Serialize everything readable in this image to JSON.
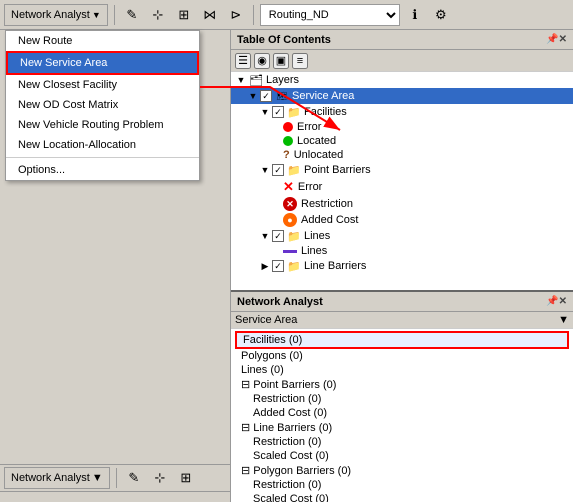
{
  "toolbar": {
    "network_analyst_label": "Network Analyst",
    "dropdown_arrow": "▼",
    "network_dropdown_value": "Routing_ND"
  },
  "dropdown_menu": {
    "items": [
      {
        "id": "new-route",
        "label": "New Route",
        "selected": false
      },
      {
        "id": "new-service-area",
        "label": "New Service Area",
        "selected": true
      },
      {
        "id": "new-closest-facility",
        "label": "New Closest Facility",
        "selected": false
      },
      {
        "id": "new-od-cost-matrix",
        "label": "New OD Cost Matrix",
        "selected": false
      },
      {
        "id": "new-vehicle-routing",
        "label": "New Vehicle Routing Problem",
        "selected": false
      },
      {
        "id": "new-location-allocation",
        "label": "New Location-Allocation",
        "selected": false
      },
      {
        "id": "options",
        "label": "Options...",
        "selected": false
      }
    ]
  },
  "toc": {
    "title": "Table Of Contents",
    "layers_label": "Layers",
    "tree": [
      {
        "id": "layers",
        "label": "Layers",
        "level": 0,
        "type": "folder",
        "expanded": true
      },
      {
        "id": "service-area",
        "label": "Service Area",
        "level": 1,
        "type": "layer",
        "checked": true,
        "expanded": true
      },
      {
        "id": "facilities",
        "label": "Facilities",
        "level": 2,
        "type": "group",
        "checked": true,
        "expanded": true
      },
      {
        "id": "error",
        "label": "Error",
        "level": 3,
        "type": "legend-red-dot"
      },
      {
        "id": "located",
        "label": "Located",
        "level": 3,
        "type": "legend-green-dot"
      },
      {
        "id": "unlocated",
        "label": "Unlocated",
        "level": 3,
        "type": "legend-question"
      },
      {
        "id": "point-barriers",
        "label": "Point Barriers",
        "level": 2,
        "type": "group",
        "checked": true,
        "expanded": true
      },
      {
        "id": "point-error",
        "label": "Error",
        "level": 3,
        "type": "legend-red-x"
      },
      {
        "id": "restriction",
        "label": "Restriction",
        "level": 3,
        "type": "legend-red-circle-x"
      },
      {
        "id": "added-cost",
        "label": "Added Cost",
        "level": 3,
        "type": "legend-orange-circle"
      },
      {
        "id": "lines",
        "label": "Lines",
        "level": 2,
        "type": "group",
        "checked": true,
        "expanded": true
      },
      {
        "id": "lines-item",
        "label": "Lines",
        "level": 3,
        "type": "legend-purple-line"
      },
      {
        "id": "line-barriers",
        "label": "Line Barriers",
        "level": 2,
        "type": "group",
        "checked": true,
        "expanded": false
      }
    ]
  },
  "na_panel": {
    "title": "Network Analyst",
    "service_area_label": "Service Area",
    "items": [
      {
        "id": "facilities",
        "label": "Facilities (0)",
        "level": 0,
        "highlighted": true
      },
      {
        "id": "polygons",
        "label": "Polygons (0)",
        "level": 0
      },
      {
        "id": "lines",
        "label": "Lines (0)",
        "level": 0
      },
      {
        "id": "point-barriers-header",
        "label": "Point Barriers (0)",
        "level": 0,
        "section": true
      },
      {
        "id": "pb-restriction",
        "label": "Restriction (0)",
        "level": 1
      },
      {
        "id": "pb-added-cost",
        "label": "Added Cost (0)",
        "level": 1
      },
      {
        "id": "line-barriers-header",
        "label": "Line Barriers (0)",
        "level": 0,
        "section": true
      },
      {
        "id": "lb-restriction",
        "label": "Restriction (0)",
        "level": 1
      },
      {
        "id": "lb-scaled-cost",
        "label": "Scaled Cost (0)",
        "level": 1
      },
      {
        "id": "polygon-barriers-header",
        "label": "Polygon Barriers (0)",
        "level": 0,
        "section": true
      },
      {
        "id": "polb-restriction",
        "label": "Restriction (0)",
        "level": 1
      },
      {
        "id": "polb-scaled-cost",
        "label": "Scaled Cost (0)",
        "level": 1
      }
    ]
  }
}
